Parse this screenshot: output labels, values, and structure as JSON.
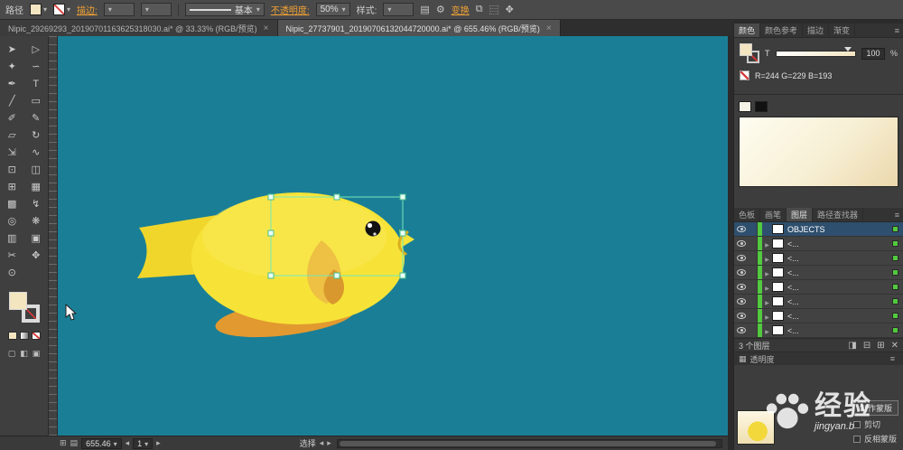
{
  "control_bar": {
    "context_label": "路径",
    "stroke_link": "描边:",
    "brush_definition": "基本",
    "opacity_link": "不透明度:",
    "opacity_value": "50%",
    "style_label": "样式:",
    "transform_link": "变换"
  },
  "document_tabs": [
    {
      "label": "Nipic_29269293_20190701163625318030.ai* @ 33.33% (RGB/预览)",
      "close_icon": "×"
    },
    {
      "label": "Nipic_27737901_20190706132044720000.ai* @ 655.46% (RGB/预览)",
      "close_icon": "×"
    }
  ],
  "tools": [
    {
      "name": "selection",
      "glyph": "➤"
    },
    {
      "name": "direct-selection",
      "glyph": "▷"
    },
    {
      "name": "magic-wand",
      "glyph": "✦"
    },
    {
      "name": "lasso",
      "glyph": "∽"
    },
    {
      "name": "pen",
      "glyph": "✒"
    },
    {
      "name": "type",
      "glyph": "T"
    },
    {
      "name": "line-segment",
      "glyph": "╱"
    },
    {
      "name": "rectangle",
      "glyph": "▭"
    },
    {
      "name": "paintbrush",
      "glyph": "✐"
    },
    {
      "name": "pencil",
      "glyph": "✎"
    },
    {
      "name": "eraser",
      "glyph": "▱"
    },
    {
      "name": "rotate",
      "glyph": "↻"
    },
    {
      "name": "scale",
      "glyph": "⇲"
    },
    {
      "name": "width",
      "glyph": "∿"
    },
    {
      "name": "free-transform",
      "glyph": "⊡"
    },
    {
      "name": "shape-builder",
      "glyph": "◫"
    },
    {
      "name": "perspective-grid",
      "glyph": "⊞"
    },
    {
      "name": "mesh",
      "glyph": "▦"
    },
    {
      "name": "gradient",
      "glyph": "▩"
    },
    {
      "name": "eyedropper",
      "glyph": "↯"
    },
    {
      "name": "blend",
      "glyph": "◎"
    },
    {
      "name": "symbol-sprayer",
      "glyph": "❋"
    },
    {
      "name": "column-graph",
      "glyph": "▥"
    },
    {
      "name": "artboard",
      "glyph": "▣"
    },
    {
      "name": "slice",
      "glyph": "✂"
    },
    {
      "name": "hand",
      "glyph": "✥"
    },
    {
      "name": "zoom",
      "glyph": "⊙"
    }
  ],
  "color_panel": {
    "tabs": [
      "颜色",
      "颜色参考",
      "描边",
      "渐变"
    ],
    "tint_label": "T",
    "tint_value": "100",
    "percent_sign": "%",
    "rgb_readout": "R=244  G=229  B=193"
  },
  "layers_panel": {
    "tabs": [
      "色板",
      "画笔",
      "图层",
      "路径查找器"
    ],
    "rows": [
      {
        "name": "OBJECTS"
      },
      {
        "name": "<..."
      },
      {
        "name": "<..."
      },
      {
        "name": "<..."
      },
      {
        "name": "<..."
      },
      {
        "name": "<..."
      },
      {
        "name": "<..."
      },
      {
        "name": "<..."
      }
    ],
    "status": "3 个图层",
    "footer_icons": [
      {
        "name": "make-clip-mask",
        "glyph": "◨"
      },
      {
        "name": "new-sublayer",
        "glyph": "⊟"
      },
      {
        "name": "new-layer",
        "glyph": "⊞"
      },
      {
        "name": "delete-layer",
        "glyph": "✕"
      }
    ]
  },
  "transparency_panel": {
    "tab": "透明度",
    "make_mask_button": "制作蒙版",
    "clip_checkbox": "剪切",
    "invert_checkbox": "反相蒙版"
  },
  "status_bar": {
    "zoom_value": "655.46",
    "artboard_value": "1",
    "tool_name": "选择"
  },
  "watermark": {
    "brand_text": "经验",
    "url_text": "jingyan.b"
  },
  "colors": {
    "canvas_teal": "#1A7F96",
    "fish_body": "#F7E337",
    "fish_body_light": "#FAEA5C",
    "fish_tail": "#F0D62B",
    "fish_fin": "#EEC043",
    "fish_fin_dark": "#D9982E",
    "fish_belly_fin": "#E2992F",
    "selection_green": "#72E8B8",
    "handle_fill": "#EAFFF5",
    "link_orange": "#F0A235",
    "fill_cream": "#F4E5C1",
    "layer_green": "#52C93F"
  }
}
